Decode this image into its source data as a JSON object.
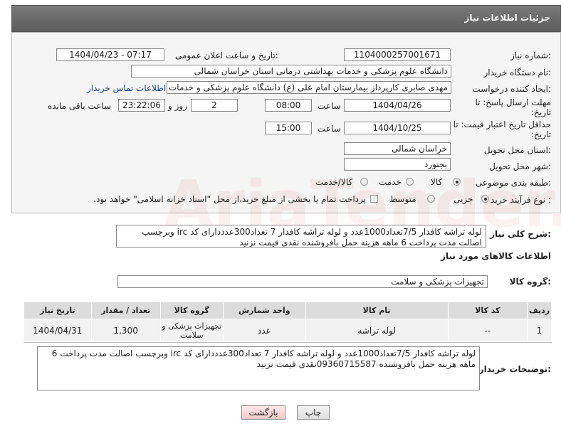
{
  "page_title": "جزئیات اطلاعات نیاز",
  "fields": {
    "need_number_label": "شماره نیاز:",
    "need_number": "1104000257001671",
    "announce_label": "تاریخ و ساعت اعلان عمومی:",
    "announce_value": "1404/04/23 - 07:17",
    "buyer_org_label": "نام دستگاه خریدار:",
    "buyer_org": "دانشگاه علوم پزشکی و خدمات بهداشتی درمانی استان خراسان شمالی",
    "requester_label": "ایجاد کننده درخواست:",
    "requester": "مهدی صابری کارپرداز بیمارستان امام علی (ع) دانشگاه علوم پزشکی و خدمات د",
    "contact_link": "اطلاعات تماس خریدار",
    "deadline_label": "مهلت ارسال پاسخ: تا تاریخ:",
    "deadline_date": "1404/04/26",
    "time_label": "ساعت",
    "deadline_time": "08:00",
    "days_value": "2",
    "days_label": "روز و",
    "remaining_time": "23:22:06",
    "remaining_label": "ساعت باقی مانده",
    "validity_label": "حداقل تاریخ اعتبار قیمت: تا تاریخ:",
    "validity_date": "1404/10/25",
    "validity_time": "15:00",
    "province_label": "استان محل تحویل:",
    "province": "خراسان شمالی",
    "city_label": "شهر محل تحویل:",
    "city": "بجنورد",
    "category_label": "طبقه بندی موضوعی:",
    "cat_goods": "کالا",
    "cat_service": "خدمت",
    "cat_goods_service": "کالا/خدمت",
    "purchase_type_label": "نوع فرآیند خرید :",
    "pt_partial": "جزیی",
    "pt_medium": "متوسط",
    "payment_note": "پرداخت تمام یا بخشی از مبلغ خرید،از محل \"اسناد خزانه اسلامی\" خواهد بود."
  },
  "description": {
    "label": "شرح کلی نیاز:",
    "text": "لوله تراشه کافدار 7/5تعداد1000عدد و لوله تراشه کافدار 7 تعداد300عدددارای کد irc وبرچسب اصالت مدت پرداخت 6 ماهه هزینه حمل بافروشنده نقدی قیمت نزنید"
  },
  "goods_info_title": "اطلاعات کالاهای مورد نیاز",
  "goods_group": {
    "label": "گروه کالا:",
    "value": "تجهیزات پزشکی و سلامت"
  },
  "table": {
    "headers": [
      "ردیف",
      "کد کالا",
      "نام کالا",
      "واحد شمارش",
      "گروه کالا",
      "تعداد / مقدار",
      "تاریخ نیاز"
    ],
    "rows": [
      [
        "1",
        "--",
        "لوله تراشه",
        "عدد",
        "تجهیزات پزشکی و سلامت",
        "1,300",
        "1404/04/31"
      ]
    ]
  },
  "buyer_notes": {
    "label": "توضیحات خریدار:",
    "text": "لوله تراشه کافدار 7/5تعداد1000عدد و لوله تراشه کافدار 7 تعداد300عدددارای کد irc وبرچسب اصالت مدت پرداخت 6 ماهه هزینه حمل بافروشنده 09360715587نقدی قیمت نزنید"
  },
  "buttons": {
    "print": "چاپ",
    "back": "بازگشت"
  },
  "watermark": "AriaTender.neT"
}
